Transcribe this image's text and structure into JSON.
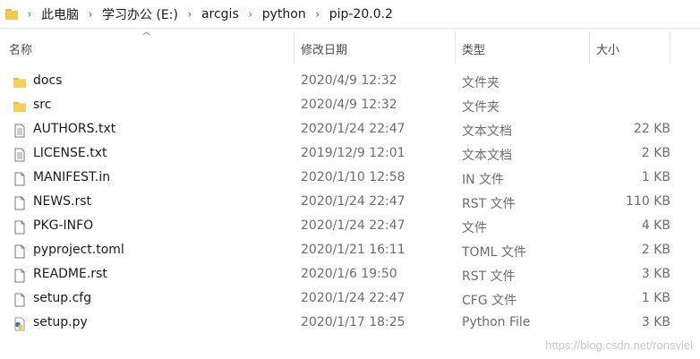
{
  "address_bar": {
    "crumbs": [
      "此电脑",
      "学习办公 (E:)",
      "arcgis",
      "python",
      "pip-20.0.2"
    ]
  },
  "columns": {
    "name": "名称",
    "date": "修改日期",
    "type": "类型",
    "size": "大小"
  },
  "files": [
    {
      "name": "docs",
      "date": "2020/4/9 12:32",
      "type": "文件夹",
      "size": "",
      "icon": "folder-icon"
    },
    {
      "name": "src",
      "date": "2020/4/9 12:32",
      "type": "文件夹",
      "size": "",
      "icon": "folder-icon"
    },
    {
      "name": "AUTHORS.txt",
      "date": "2020/1/24 22:47",
      "type": "文本文档",
      "size": "22 KB",
      "icon": "text-file-icon"
    },
    {
      "name": "LICENSE.txt",
      "date": "2019/12/9 12:01",
      "type": "文本文档",
      "size": "2 KB",
      "icon": "text-file-icon"
    },
    {
      "name": "MANIFEST.in",
      "date": "2020/1/10 12:58",
      "type": "IN 文件",
      "size": "1 KB",
      "icon": "file-icon"
    },
    {
      "name": "NEWS.rst",
      "date": "2020/1/24 22:47",
      "type": "RST 文件",
      "size": "110 KB",
      "icon": "file-icon"
    },
    {
      "name": "PKG-INFO",
      "date": "2020/1/24 22:47",
      "type": "文件",
      "size": "4 KB",
      "icon": "file-icon"
    },
    {
      "name": "pyproject.toml",
      "date": "2020/1/21 16:11",
      "type": "TOML 文件",
      "size": "2 KB",
      "icon": "file-icon"
    },
    {
      "name": "README.rst",
      "date": "2020/1/6 19:50",
      "type": "RST 文件",
      "size": "3 KB",
      "icon": "file-icon"
    },
    {
      "name": "setup.cfg",
      "date": "2020/1/24 22:47",
      "type": "CFG 文件",
      "size": "1 KB",
      "icon": "file-icon"
    },
    {
      "name": "setup.py",
      "date": "2020/1/17 18:25",
      "type": "Python File",
      "size": "3 KB",
      "icon": "python-file-icon"
    }
  ],
  "watermark": "https://blog.csdn.net/ronsviel"
}
